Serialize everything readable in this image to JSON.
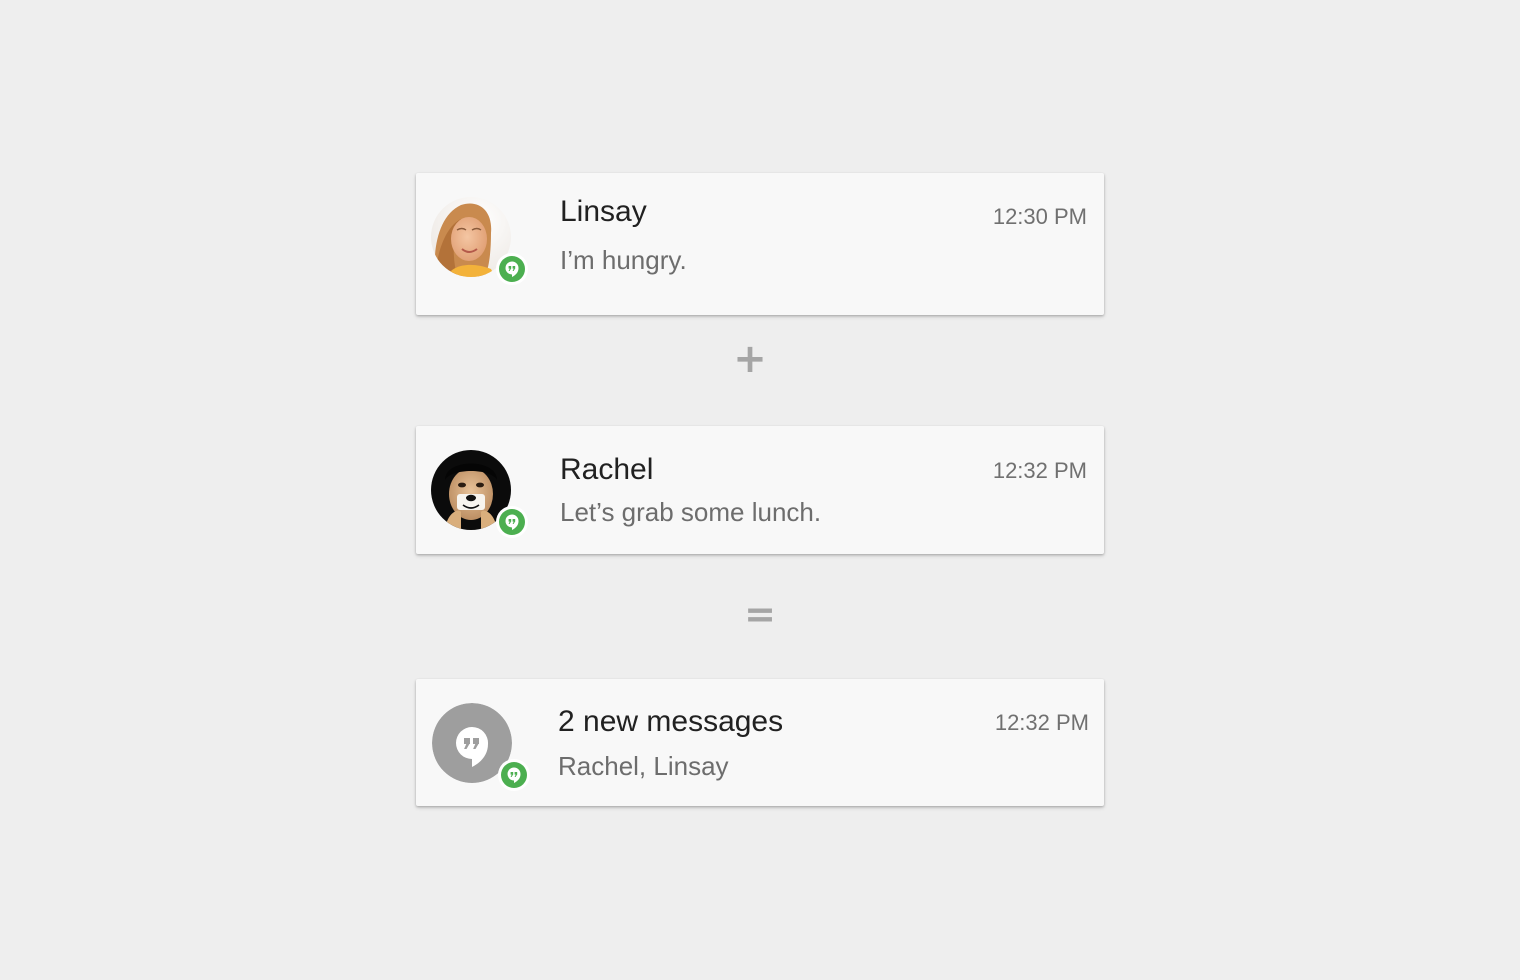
{
  "notifications": [
    {
      "sender": "Linsay",
      "message": "I’m hungry.",
      "time": "12:30 PM",
      "avatar": "photo-avatar-linsay",
      "badge_icon": "hangouts-icon"
    },
    {
      "sender": "Rachel",
      "message": "Let’s grab some lunch.",
      "time": "12:32 PM",
      "avatar": "photo-avatar-rachel",
      "badge_icon": "hangouts-icon"
    },
    {
      "sender": "2 new messages",
      "message": "Rachel, Linsay",
      "time": "12:32 PM",
      "avatar": "hangouts-icon",
      "badge_icon": "hangouts-icon"
    }
  ],
  "operators": {
    "plus": "+",
    "equals": "="
  },
  "colors": {
    "background": "#eeeeee",
    "card": "#f8f8f8",
    "hangouts_green": "#4caf50",
    "group_avatar_gray": "#9e9e9e",
    "operator_gray": "#a5a5a5"
  }
}
